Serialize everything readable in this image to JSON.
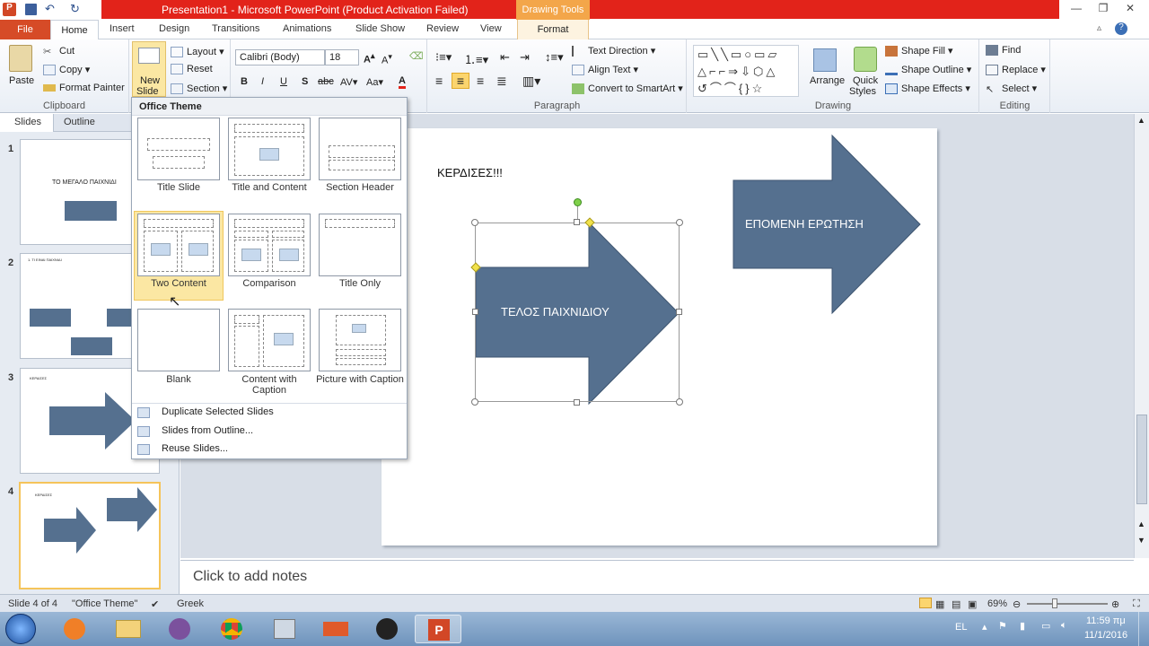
{
  "window": {
    "title": "Presentation1  -  Microsoft PowerPoint (Product Activation Failed)",
    "contextual_tab": "Drawing Tools"
  },
  "tabs": [
    "File",
    "Home",
    "Insert",
    "Design",
    "Transitions",
    "Animations",
    "Slide Show",
    "Review",
    "View",
    "Format"
  ],
  "clipboard": {
    "paste": "Paste",
    "cut": "Cut",
    "copy": "Copy",
    "format_painter": "Format Painter",
    "label": "Clipboard"
  },
  "slides_group": {
    "new_slide_line1": "New",
    "new_slide_line2": "Slide",
    "layout": "Layout",
    "reset": "Reset",
    "section": "Section"
  },
  "font": {
    "name": "Calibri (Body)",
    "size": "18"
  },
  "paragraph": {
    "text_direction": "Text Direction",
    "align_text": "Align Text",
    "convert": "Convert to SmartArt",
    "label": "Paragraph"
  },
  "drawing": {
    "arrange": "Arrange",
    "quick_styles_1": "Quick",
    "quick_styles_2": "Styles",
    "shape_fill": "Shape Fill",
    "shape_outline": "Shape Outline",
    "shape_effects": "Shape Effects",
    "label": "Drawing"
  },
  "editing": {
    "find": "Find",
    "replace": "Replace",
    "select": "Select",
    "label": "Editing"
  },
  "panel_tabs": {
    "slides": "Slides",
    "outline": "Outline"
  },
  "thumbnails": [
    {
      "num": "1",
      "title": "ΤΟ ΜΕΓΑΛΟ ΠΑΙΧΝΙΔΙ"
    },
    {
      "num": "2",
      "title": "1. ΤΙ ΕΙΝΑΙ ΠΑΙΧΝΙΔΙ"
    },
    {
      "num": "3",
      "title": "ΚΕΡΔΙΣΕΣ"
    },
    {
      "num": "4",
      "title": "ΚΕΡΔΙΣΕΣ"
    }
  ],
  "slide": {
    "text": "ΚΕΡΔΙΣΕΣ!!!",
    "arrow_left": "ΤΕΛΟΣ ΠΑΙΧΝΙΔΙΟΥ",
    "arrow_right": "ΕΠΟΜΕΝΗ ΕΡΩΤΗΣΗ"
  },
  "notes_placeholder": "Click to add notes",
  "menu": {
    "header": "Office Theme",
    "layouts": [
      "Title Slide",
      "Title and Content",
      "Section Header",
      "Two Content",
      "Comparison",
      "Title Only",
      "Blank",
      "Content with Caption",
      "Picture with Caption"
    ],
    "items": [
      "Duplicate Selected Slides",
      "Slides from Outline...",
      "Reuse Slides..."
    ]
  },
  "status": {
    "slide": "Slide 4 of 4",
    "theme": "\"Office Theme\"",
    "language": "Greek",
    "zoom": "69%"
  },
  "taskbar": {
    "lang": "EL",
    "time": "11:59 πμ",
    "date": "11/1/2016"
  },
  "colors": {
    "arrow": "#55708f",
    "accent_red": "#e2231a",
    "file_tab": "#d64b27",
    "highlight": "#fbe7a3"
  }
}
